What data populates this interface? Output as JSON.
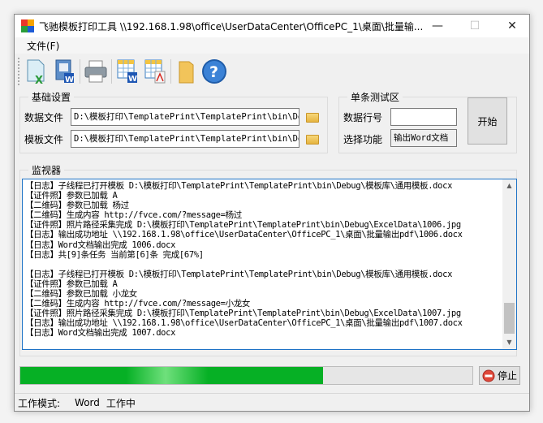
{
  "window": {
    "title": "飞驰模板打印工具 \\\\192.168.1.98\\office\\UserDataCenter\\OfficePC_1\\桌面\\批量输...",
    "minimize": "—",
    "maximize": "☐",
    "close": "✕"
  },
  "menu": {
    "file": "文件(F)"
  },
  "toolbar": {
    "icons": [
      "excel-doc-icon",
      "word-book-icon",
      "printer-icon",
      "table-to-word-icon",
      "table-to-pdf-icon",
      "folder-icon",
      "help-icon"
    ]
  },
  "basic_settings": {
    "legend": "基础设置",
    "data_file_label": "数据文件",
    "data_file_value": "D:\\模板打印\\TemplatePrint\\TemplatePrint\\bin\\Debug",
    "template_file_label": "模板文件",
    "template_file_value": "D:\\模板打印\\TemplatePrint\\TemplatePrint\\bin\\Debug"
  },
  "single_test": {
    "legend": "单条测试区",
    "row_label": "数据行号",
    "row_value": "",
    "function_label": "选择功能",
    "function_value": "输出Word文档",
    "start": "开始"
  },
  "monitor": {
    "legend": "监视器",
    "lines": [
      "【日志】子线程已打开模板 D:\\模板打印\\TemplatePrint\\TemplatePrint\\bin\\Debug\\模板库\\通用模板.docx",
      "【证件照】参数已加载 A",
      "【二维码】参数已加载 杨过",
      "【二维码】生成内容 http://fvce.com/?message=杨过",
      "【证件照】照片路径采集完成 D:\\模板打印\\TemplatePrint\\TemplatePrint\\bin\\Debug\\ExcelData\\1006.jpg",
      "【日志】输出成功地址 \\\\192.168.1.98\\office\\UserDataCenter\\OfficePC_1\\桌面\\批量输出pdf\\1006.docx",
      "【日志】Word文档输出完成 1006.docx",
      "【日志】共[9]条任务 当前第[6]条 完成[67%]",
      "",
      "【日志】子线程已打开模板 D:\\模板打印\\TemplatePrint\\TemplatePrint\\bin\\Debug\\模板库\\通用模板.docx",
      "【证件照】参数已加载 A",
      "【二维码】参数已加载 小龙女",
      "【二维码】生成内容 http://fvce.com/?message=小龙女",
      "【证件照】照片路径采集完成 D:\\模板打印\\TemplatePrint\\TemplatePrint\\bin\\Debug\\ExcelData\\1007.jpg",
      "【日志】输出成功地址 \\\\192.168.1.98\\office\\UserDataCenter\\OfficePC_1\\桌面\\批量输出pdf\\1007.docx",
      "【日志】Word文档输出完成 1007.docx"
    ]
  },
  "progress": {
    "percent": 67,
    "color": "#06b025"
  },
  "stop": "停止",
  "status": {
    "mode_label": "工作模式:",
    "mode_value": "Word",
    "state": "工作中"
  }
}
